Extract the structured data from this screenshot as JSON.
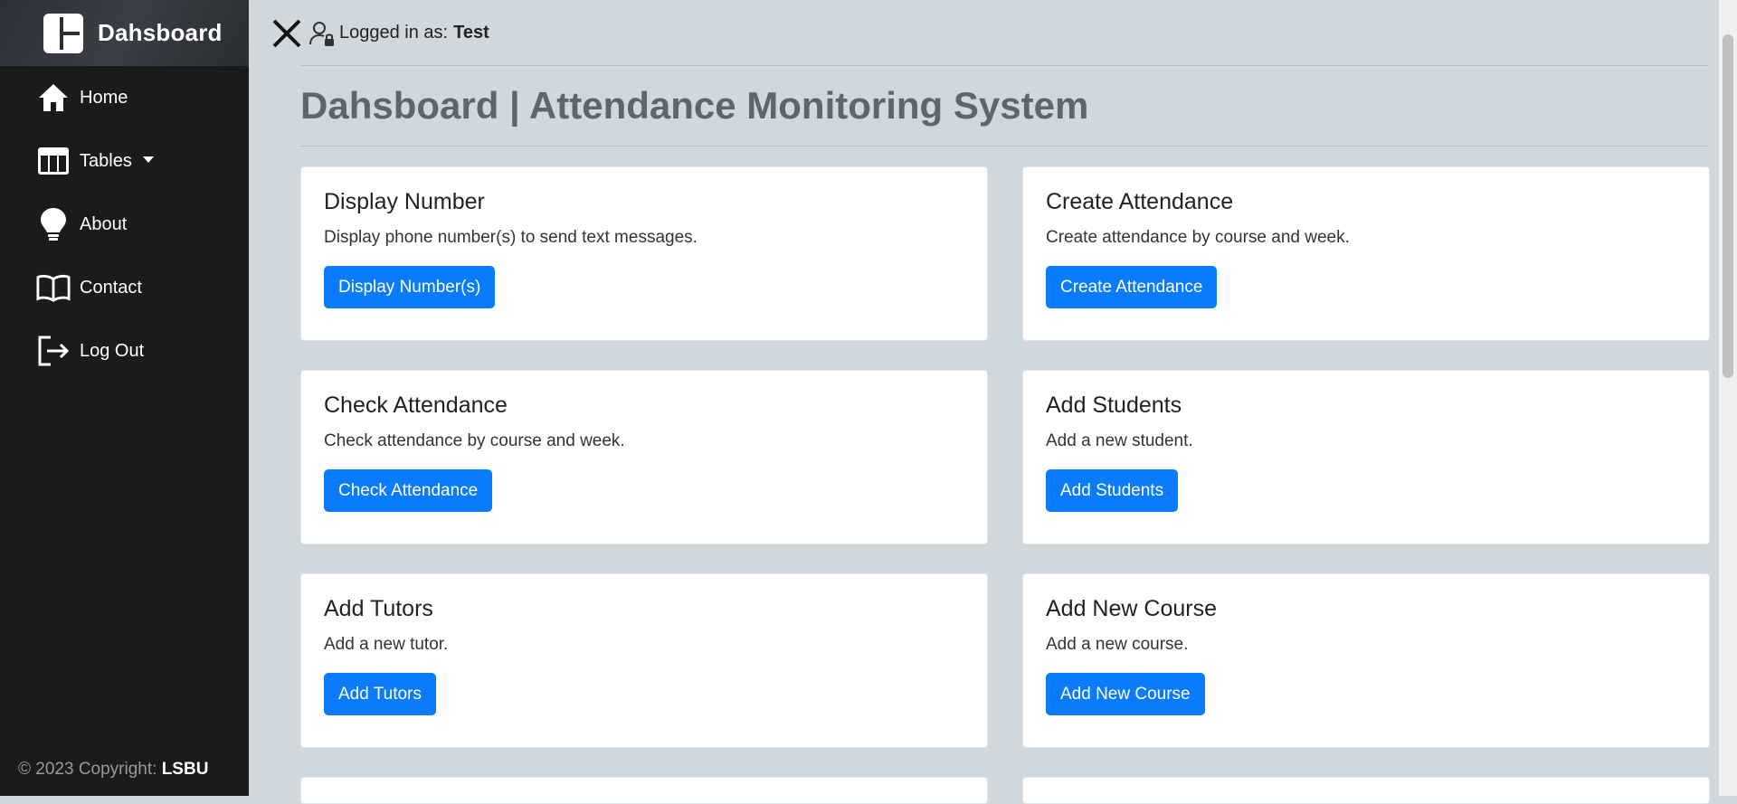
{
  "sidebar": {
    "brand": "Dahsboard",
    "items": [
      {
        "label": "Home",
        "icon": "home-icon"
      },
      {
        "label": "Tables",
        "icon": "table-icon"
      },
      {
        "label": "About",
        "icon": "lightbulb-icon"
      },
      {
        "label": "Contact",
        "icon": "book-icon"
      },
      {
        "label": "Log Out",
        "icon": "logout-icon"
      }
    ],
    "copyright_prefix": "© 2023 Copyright:",
    "copyright_owner": "LSBU"
  },
  "topbar": {
    "logged_label": "Logged in as:",
    "username": "Test"
  },
  "main": {
    "title": "Dahsboard | Attendance Monitoring System",
    "cards": [
      {
        "title": "Display Number",
        "text": "Display phone number(s) to send text messages.",
        "button": "Display Number(s)"
      },
      {
        "title": "Create Attendance",
        "text": "Create attendance by course and week.",
        "button": "Create Attendance"
      },
      {
        "title": "Check Attendance",
        "text": "Check attendance by course and week.",
        "button": "Check Attendance"
      },
      {
        "title": "Add Students",
        "text": "Add a new student.",
        "button": "Add Students"
      },
      {
        "title": "Add Tutors",
        "text": "Add a new tutor.",
        "button": "Add Tutors"
      },
      {
        "title": "Add New Course",
        "text": "Add a new course.",
        "button": "Add New Course"
      }
    ]
  },
  "colors": {
    "sidebar_bg": "#1b1b1c",
    "page_bg": "#d0d8de",
    "primary": "#0a7bfa",
    "title": "#5b6670"
  }
}
